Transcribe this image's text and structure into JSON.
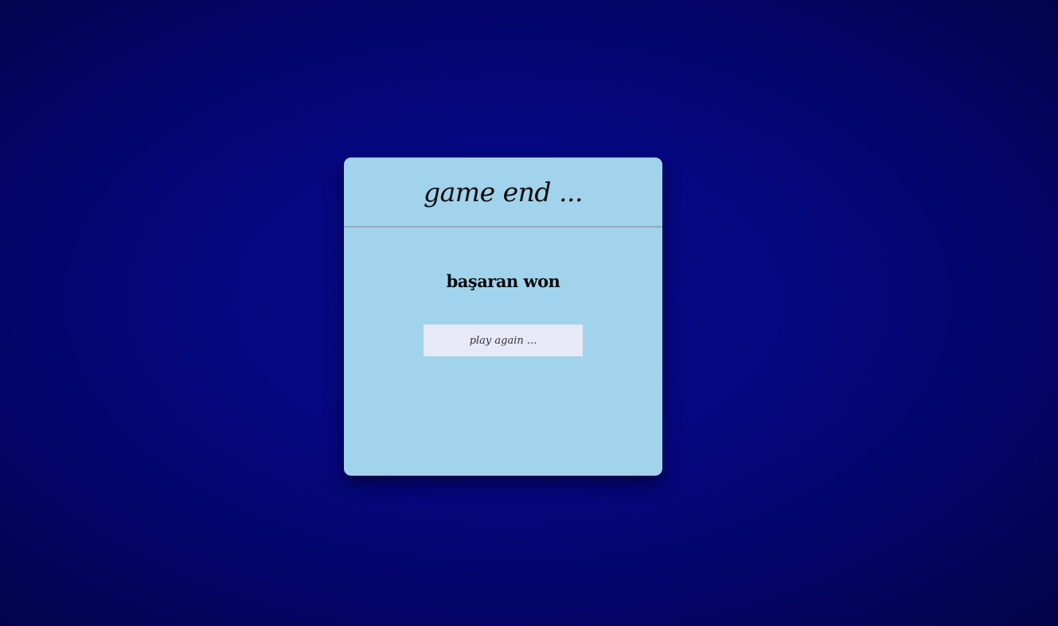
{
  "dialog": {
    "title": "game end ...",
    "winner_message": "başaran won",
    "play_again_label": "play again ..."
  },
  "colors": {
    "background_center": "#070a8a",
    "background_edge": "#020346",
    "dialog_background": "#a1d3ec",
    "button_background": "#e7eaf6",
    "divider": "#9aa9b3"
  }
}
